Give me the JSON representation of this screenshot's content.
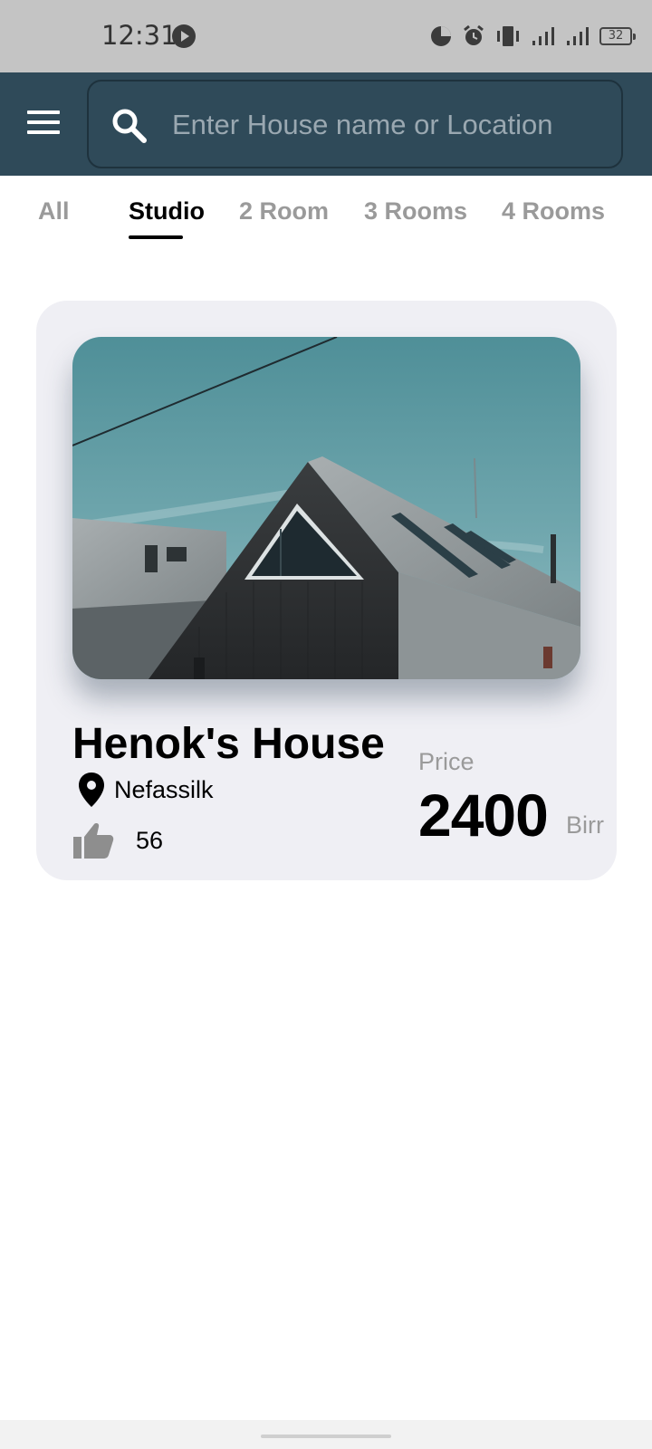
{
  "status_bar": {
    "time": "12:31",
    "battery": "32",
    "icons": [
      "media-play-icon",
      "data-saver-icon",
      "alarm-icon",
      "vibrate-icon",
      "signal-icon",
      "signal-icon-2",
      "battery-icon"
    ]
  },
  "app_bar": {
    "menu_icon": "hamburger-menu-icon",
    "search_icon": "search-icon",
    "search_placeholder": "Enter House name or Location",
    "search_value": ""
  },
  "tabs": [
    {
      "label": "All",
      "active": false
    },
    {
      "label": "Studio",
      "active": true
    },
    {
      "label": "2 Room",
      "active": false
    },
    {
      "label": "3 Rooms",
      "active": false
    },
    {
      "label": "4 Rooms",
      "active": false
    }
  ],
  "listing": {
    "name": "Henok's House",
    "location": "Nefassilk",
    "likes": "56",
    "price_label": "Price",
    "price": "2400",
    "currency": "Birr"
  },
  "colors": {
    "app_bar": "#2f4a59",
    "card_bg": "#efeff4",
    "muted_text": "#9a9a9a",
    "status_bar": "#c4c4c4"
  }
}
